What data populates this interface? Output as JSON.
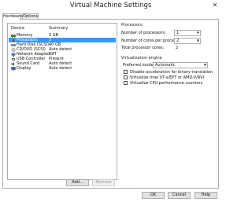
{
  "window": {
    "title": "Virtual Machine Settings"
  },
  "tabs": [
    {
      "label": "Hardware"
    },
    {
      "label": "Options"
    }
  ],
  "device_list": {
    "columns": {
      "device": "Device",
      "summary": "Summary"
    },
    "rows": [
      {
        "device": "Memory",
        "summary": "3 GB",
        "icon": "memory-icon"
      },
      {
        "device": "Processors",
        "summary": "2",
        "icon": "processor-icon",
        "selected": true
      },
      {
        "device": "Hard Disk (SCSI)",
        "summary": "40 GB",
        "icon": "hard-disk-icon"
      },
      {
        "device": "CD/DVD (SCSI)",
        "summary": "Auto detect",
        "icon": "cd-dvd-icon"
      },
      {
        "device": "Network Adapter",
        "summary": "NAT",
        "icon": "network-adapter-icon"
      },
      {
        "device": "USB Controller",
        "summary": "Present",
        "icon": "usb-controller-icon"
      },
      {
        "device": "Sound Card",
        "summary": "Auto detect",
        "icon": "sound-card-icon"
      },
      {
        "device": "Display",
        "summary": "Auto detect",
        "icon": "display-icon"
      }
    ]
  },
  "buttons": {
    "add": "Add...",
    "remove": "Remove",
    "ok": "OK",
    "cancel": "Cancel",
    "help": "Help"
  },
  "processors": {
    "title": "Processors",
    "num_processors_label": "Number of processors:",
    "num_processors_value": "1",
    "cores_label": "Number of cores per processor:",
    "cores_value": "2",
    "total_label": "Total processor cores:",
    "total_value": "2"
  },
  "virtualization": {
    "title": "Virtualization engine",
    "mode_label": "Preferred mode:",
    "mode_value": "Automatic",
    "options": [
      {
        "label": "Disable acceleration for binary translation",
        "checked": false
      },
      {
        "label": "Virtualize Intel VT-x/EPT or AMD-V/RVI",
        "checked": false
      },
      {
        "label": "Virtualize CPU performance counters",
        "checked": false
      }
    ]
  },
  "colors": {
    "selection": "#3399ff",
    "border": "#adadad",
    "button": "#e1e1e1"
  }
}
